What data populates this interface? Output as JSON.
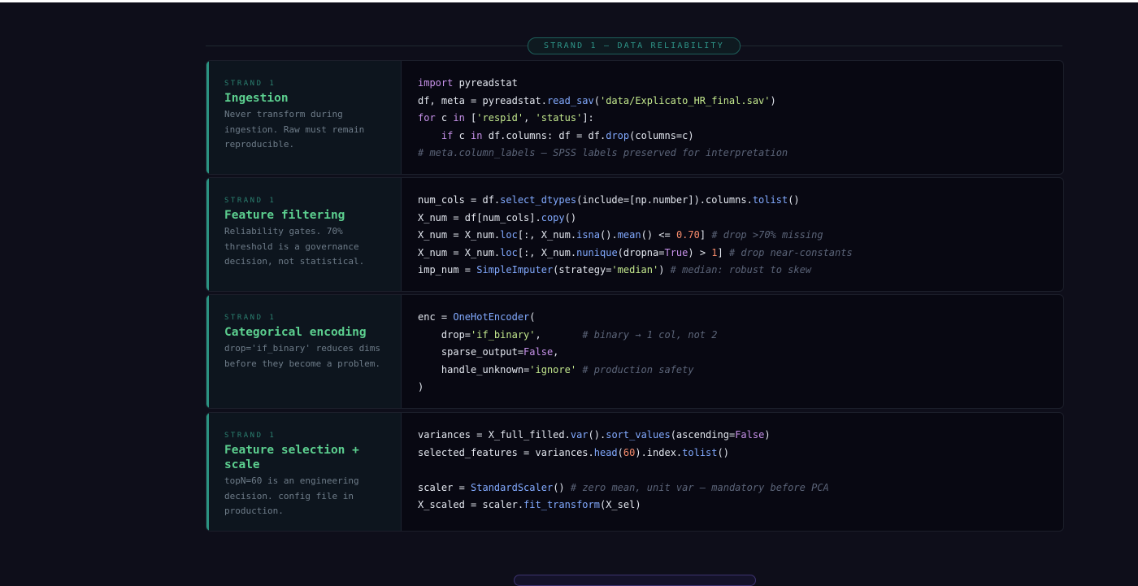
{
  "strand_header": "STRAND 1 — DATA RELIABILITY",
  "cards": [
    {
      "eyebrow": "STRAND 1",
      "title": "Ingestion",
      "desc": "Never transform during ingestion. Raw must remain reproducible.",
      "code": [
        [
          [
            "k",
            "import"
          ],
          [
            "t",
            " pyreadstat"
          ]
        ],
        [
          [
            "t",
            "df, meta = pyreadstat."
          ],
          [
            "f",
            "read_sav"
          ],
          [
            "t",
            "("
          ],
          [
            "s",
            "'data/Explicato_HR_final.sav'"
          ],
          [
            "t",
            ")"
          ]
        ],
        [
          [
            "k",
            "for"
          ],
          [
            "t",
            " c "
          ],
          [
            "k",
            "in"
          ],
          [
            "t",
            " ["
          ],
          [
            "s",
            "'respid'"
          ],
          [
            "t",
            ", "
          ],
          [
            "s",
            "'status'"
          ],
          [
            "t",
            "]:"
          ]
        ],
        [
          [
            "t",
            "    "
          ],
          [
            "k",
            "if"
          ],
          [
            "t",
            " c "
          ],
          [
            "k",
            "in"
          ],
          [
            "t",
            " df.columns: df = df."
          ],
          [
            "f",
            "drop"
          ],
          [
            "t",
            "(columns=c)"
          ]
        ],
        [
          [
            "c",
            "# meta.column_labels — SPSS labels preserved for interpretation"
          ]
        ]
      ]
    },
    {
      "eyebrow": "STRAND 1",
      "title": "Feature filtering",
      "desc": "Reliability gates. 70% threshold is a governance decision, not statistical.",
      "code": [
        [
          [
            "t",
            "num_cols = df."
          ],
          [
            "f",
            "select_dtypes"
          ],
          [
            "t",
            "(include=[np.number]).columns."
          ],
          [
            "f",
            "tolist"
          ],
          [
            "t",
            "()"
          ]
        ],
        [
          [
            "t",
            "X_num = df[num_cols]."
          ],
          [
            "f",
            "copy"
          ],
          [
            "t",
            "()"
          ]
        ],
        [
          [
            "t",
            "X_num = X_num."
          ],
          [
            "f",
            "loc"
          ],
          [
            "t",
            "[:, X_num."
          ],
          [
            "f",
            "isna"
          ],
          [
            "t",
            "()."
          ],
          [
            "f",
            "mean"
          ],
          [
            "t",
            "() <= "
          ],
          [
            "n",
            "0.70"
          ],
          [
            "t",
            "] "
          ],
          [
            "c",
            "# drop >70% missing"
          ]
        ],
        [
          [
            "t",
            "X_num = X_num."
          ],
          [
            "f",
            "loc"
          ],
          [
            "t",
            "[:, X_num."
          ],
          [
            "f",
            "nunique"
          ],
          [
            "t",
            "(dropna="
          ],
          [
            "k",
            "True"
          ],
          [
            "t",
            ") > "
          ],
          [
            "n",
            "1"
          ],
          [
            "t",
            "] "
          ],
          [
            "c",
            "# drop near-constants"
          ]
        ],
        [
          [
            "t",
            "imp_num = "
          ],
          [
            "f",
            "SimpleImputer"
          ],
          [
            "t",
            "(strategy="
          ],
          [
            "s",
            "'median'"
          ],
          [
            "t",
            ") "
          ],
          [
            "c",
            "# median: robust to skew"
          ]
        ]
      ]
    },
    {
      "eyebrow": "STRAND 1",
      "title": "Categorical encoding",
      "desc": "drop='if_binary' reduces dims before they become a problem.",
      "code": [
        [
          [
            "t",
            "enc = "
          ],
          [
            "f",
            "OneHotEncoder"
          ],
          [
            "t",
            "("
          ]
        ],
        [
          [
            "t",
            "    drop="
          ],
          [
            "s",
            "'if_binary'"
          ],
          [
            "t",
            ",       "
          ],
          [
            "c",
            "# binary → 1 col, not 2"
          ]
        ],
        [
          [
            "t",
            "    sparse_output="
          ],
          [
            "k",
            "False"
          ],
          [
            "t",
            ","
          ]
        ],
        [
          [
            "t",
            "    handle_unknown="
          ],
          [
            "s",
            "'ignore'"
          ],
          [
            "t",
            " "
          ],
          [
            "c",
            "# production safety"
          ]
        ],
        [
          [
            "t",
            ")"
          ]
        ]
      ]
    },
    {
      "eyebrow": "STRAND 1",
      "title": "Feature selection + scale",
      "desc": "topN=60 is an engineering decision. config file in production.",
      "code": [
        [
          [
            "t",
            "variances = X_full_filled."
          ],
          [
            "f",
            "var"
          ],
          [
            "t",
            "()."
          ],
          [
            "f",
            "sort_values"
          ],
          [
            "t",
            "(ascending="
          ],
          [
            "k",
            "False"
          ],
          [
            "t",
            ")"
          ]
        ],
        [
          [
            "t",
            "selected_features = variances."
          ],
          [
            "f",
            "head"
          ],
          [
            "t",
            "("
          ],
          [
            "n",
            "60"
          ],
          [
            "t",
            ").index."
          ],
          [
            "f",
            "tolist"
          ],
          [
            "t",
            "()"
          ]
        ],
        [
          [
            "t",
            ""
          ]
        ],
        [
          [
            "t",
            "scaler = "
          ],
          [
            "f",
            "StandardScaler"
          ],
          [
            "t",
            "() "
          ],
          [
            "c",
            "# zero mean, unit var — mandatory before PCA"
          ]
        ],
        [
          [
            "t",
            "X_scaled = scaler."
          ],
          [
            "f",
            "fit_transform"
          ],
          [
            "t",
            "(X_sel)"
          ]
        ]
      ]
    }
  ]
}
